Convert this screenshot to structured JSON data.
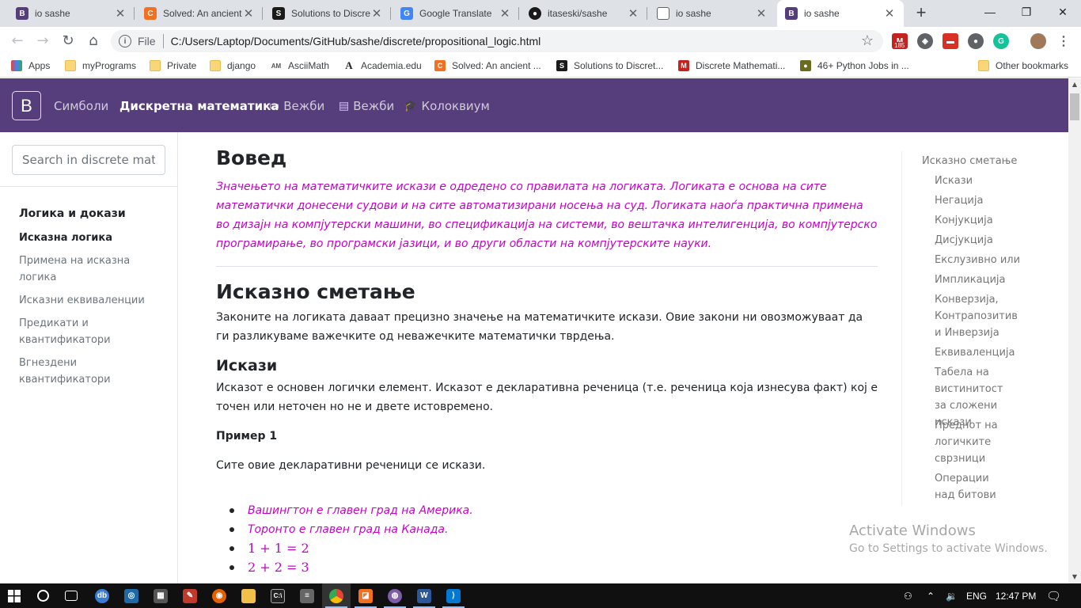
{
  "browser": {
    "tabs": [
      {
        "title": "io sashe",
        "favicon": "B",
        "color": "#563d7c"
      },
      {
        "title": "Solved: An ancient",
        "favicon": "C",
        "color": "#f37021"
      },
      {
        "title": "Solutions to Discre",
        "favicon": "S",
        "color": "#1a1a1a"
      },
      {
        "title": "Google Translate",
        "favicon": "G",
        "color": "#4285f4"
      },
      {
        "title": "itaseski/sashe",
        "favicon": "●",
        "color": "#1a1a1a"
      },
      {
        "title": "io sashe",
        "favicon": "▯",
        "color": "#9aa0a6"
      },
      {
        "title": "io sashe",
        "favicon": "B",
        "color": "#563d7c"
      }
    ],
    "new_tab": "+",
    "window": {
      "minimize": "—",
      "maximize": "❐",
      "close": "✕"
    },
    "address": {
      "scheme": "File",
      "url": "C:/Users/Laptop/Documents/GitHub/sashe/discrete/propositional_logic.html"
    },
    "extension_badge": "185",
    "bookmarks": [
      {
        "label": "Apps",
        "icon": "apps-icon"
      },
      {
        "label": "myPrograms",
        "icon": "folder-icon"
      },
      {
        "label": "Private",
        "icon": "folder-icon"
      },
      {
        "label": "django",
        "icon": "folder-icon"
      },
      {
        "label": "AsciiMath",
        "icon": "asciimath-icon"
      },
      {
        "label": "Academia.edu",
        "icon": "academia-icon"
      },
      {
        "label": "Solved: An ancient ...",
        "icon": "chegg-icon"
      },
      {
        "label": "Solutions to Discret...",
        "icon": "slader-icon"
      },
      {
        "label": "Discrete Mathemati...",
        "icon": "m-icon"
      },
      {
        "label": "46+ Python Jobs in ...",
        "icon": "job-icon"
      }
    ],
    "other_bookmarks": "Other bookmarks"
  },
  "site": {
    "brand": "B",
    "nav": [
      {
        "label": "Симболи",
        "icon": ""
      },
      {
        "label": "Дискретна математика",
        "icon": "",
        "active": true
      },
      {
        "label": "Вежби",
        "icon": "🖵"
      },
      {
        "label": "Вежби",
        "icon": "📖"
      },
      {
        "label": "Колоквиум",
        "icon": "🎓"
      }
    ]
  },
  "sidebar": {
    "search_placeholder": "Search in discrete mat",
    "group": "Логика и докази",
    "items": [
      "Исказна логика",
      "Примена на исказна логика",
      "Исказни еквиваленции",
      "Предикати и квантификатори",
      "Вгнездени квантификатори"
    ]
  },
  "content": {
    "intro_title": "Вовед",
    "intro_text": "Значењето на математичките искази е одредено со правилата на логиката. Логиката е основа на сите математички донесени судови и на сите автоматизирани носења на суд. Логиката наоѓа практична примена во дизајн на компјутерски машини, во спецификација на системи, во вештачка интелигенција, во компјутерско програмирање, во програмски јазици, и во други области на компјутерските науки.",
    "section_title": "Исказно сметање",
    "section_text": "Законите на логиката даваат прецизно значење на математичките искази. Овие закони ни овозможуваат да ги разликуваме важечките од неважечките математички тврдења.",
    "sub_title": "Искази",
    "sub_text": "Исказот е основен логички елемент. Исказот е декларативна реченица (т.е. реченица која изнесува факт) кој е точен или неточен но не и двете истовремено.",
    "example_label": "Пример 1",
    "example_intro": "Сите овие декларативни реченици се искази.",
    "examples": [
      "Вашингтон е главен град на Америка.",
      "Торонто е главен град на Канада.",
      "1 + 1 = 2",
      "2 + 2 = 3"
    ]
  },
  "toc": {
    "title": "Исказно сметање",
    "items": [
      "Искази",
      "Негација",
      "Конјукција",
      "Дисјукција",
      "Екслузивно или",
      "Импликација",
      "Конверзија, Контрапозитив и Инверзија",
      "Еквиваленција",
      "Табела на вистинитост за сложени искази",
      "Преднот на логичките сврзници",
      "Операции над битови"
    ]
  },
  "watermark": {
    "line1": "Activate Windows",
    "line2": "Go to Settings to activate Windows."
  },
  "taskbar": {
    "language": "ENG",
    "time": "12:47 PM"
  }
}
